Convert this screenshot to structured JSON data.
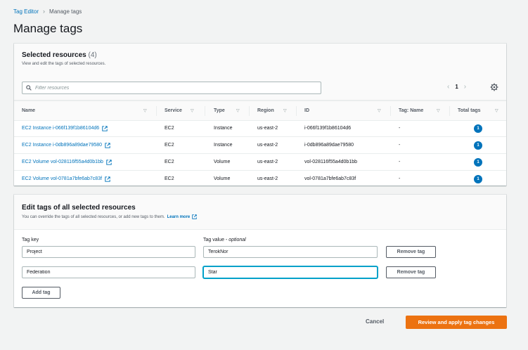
{
  "breadcrumb": {
    "parent": "Tag Editor",
    "current": "Manage tags"
  },
  "page_title": "Manage tags",
  "selected": {
    "heading": "Selected resources",
    "count": "(4)",
    "description": "View and edit the tags of selected resources.",
    "search_placeholder": "Filter resources",
    "page": "1",
    "columns": [
      "Name",
      "Service",
      "Type",
      "Region",
      "ID",
      "Tag: Name",
      "Total tags"
    ],
    "rows": [
      {
        "name": "EC2 Instance i-066f139f1b86104d6",
        "service": "EC2",
        "type": "Instance",
        "region": "us-east-2",
        "id": "i-066f139f1b86104d6",
        "tag_name": "-",
        "total": "1"
      },
      {
        "name": "EC2 Instance i-0db896a89dae79580",
        "service": "EC2",
        "type": "Instance",
        "region": "us-east-2",
        "id": "i-0db896a89dae79580",
        "tag_name": "-",
        "total": "1"
      },
      {
        "name": "EC2 Volume vol-028116f55a4d0b1bb",
        "service": "EC2",
        "type": "Volume",
        "region": "us-east-2",
        "id": "vol-028116f55a4d0b1bb",
        "tag_name": "-",
        "total": "1"
      },
      {
        "name": "EC2 Volume vol-0781a7bfe6ab7c83f",
        "service": "EC2",
        "type": "Volume",
        "region": "us-east-2",
        "id": "vol-0781a7bfe6ab7c83f",
        "tag_name": "-",
        "total": "1"
      }
    ]
  },
  "edit": {
    "heading": "Edit tags of all selected resources",
    "description": "You can override the tags of all selected resources, or add new tags to them.",
    "learn_more": "Learn more",
    "key_label": "Tag key",
    "value_label": "Tag value",
    "value_label_suffix": " - optional",
    "tags": [
      {
        "key": "Project",
        "value": "TerokNor"
      },
      {
        "key": "Federation",
        "value": "Star"
      }
    ],
    "remove_label": "Remove tag",
    "add_label": "Add tag"
  },
  "footer": {
    "cancel": "Cancel",
    "apply": "Review and apply tag changes"
  },
  "colors": {
    "link": "#0073bb",
    "primary": "#ec7211",
    "focus": "#00a1c9"
  }
}
